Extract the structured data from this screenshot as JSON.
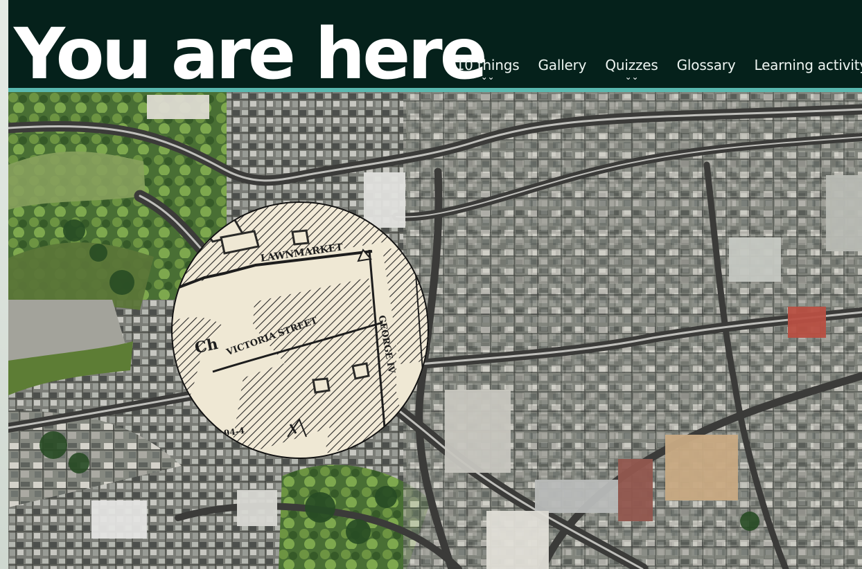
{
  "site": {
    "title": "You are here"
  },
  "nav": {
    "items": [
      {
        "label": "10 things",
        "has_dropdown": true,
        "icon": "double-chevron-down-icon"
      },
      {
        "label": "Gallery",
        "has_dropdown": false
      },
      {
        "label": "Quizzes",
        "has_dropdown": true,
        "icon": "double-chevron-down-icon"
      },
      {
        "label": "Glossary",
        "has_dropdown": false
      },
      {
        "label": "Learning activity",
        "has_dropdown": false
      }
    ]
  },
  "map": {
    "type": "aerial-map",
    "lens_labels": {
      "lawnmarket": "LAWNMARKET",
      "victoria_street": "VICTORIA STREET",
      "george_iv": "GEORGE IV",
      "fragment": "Ch",
      "grid_number": "94-4"
    }
  },
  "colors": {
    "header_bg": "#05211b",
    "accent_bar": "#59b9b0",
    "nav_text": "#eef5f2",
    "old_map_paper": "#efe8d4"
  }
}
